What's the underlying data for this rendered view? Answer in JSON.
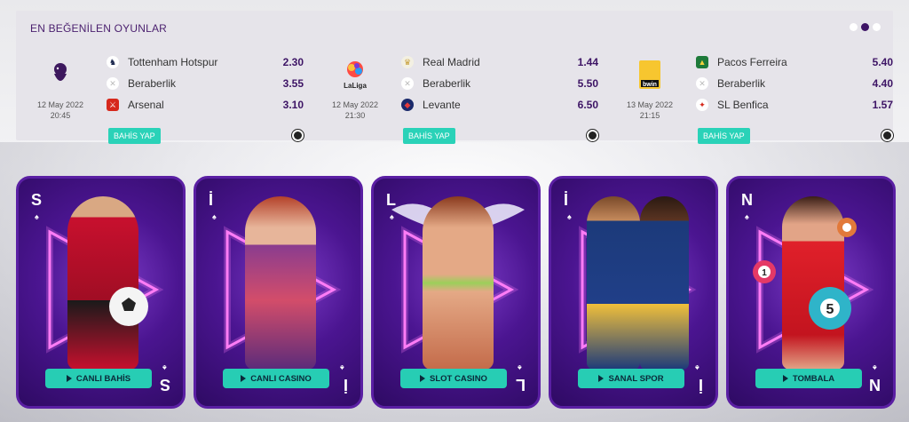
{
  "title": "EN BEĞENİLEN OYUNLAR",
  "bet_label": "BAHİS YAP",
  "matches": [
    {
      "league_icon": "premier-league-icon",
      "date": "12 May 2022",
      "time": "20:45",
      "rows": [
        {
          "team": "Tottenham Hotspur",
          "odd": "2.30",
          "icon": "tottenham-icon"
        },
        {
          "team": "Beraberlik",
          "odd": "3.55",
          "icon": "draw-icon"
        },
        {
          "team": "Arsenal",
          "odd": "3.10",
          "icon": "arsenal-icon"
        }
      ]
    },
    {
      "league_icon": "laliga-icon",
      "league_text": "LaLiga",
      "date": "12 May 2022",
      "time": "21:30",
      "rows": [
        {
          "team": "Real Madrid",
          "odd": "1.44",
          "icon": "real-madrid-icon"
        },
        {
          "team": "Beraberlik",
          "odd": "5.50",
          "icon": "draw-icon"
        },
        {
          "team": "Levante",
          "odd": "6.50",
          "icon": "levante-icon"
        }
      ]
    },
    {
      "league_icon": "liga-portugal-bwin-icon",
      "league_text": "bwin",
      "date": "13 May 2022",
      "time": "21:15",
      "rows": [
        {
          "team": "Pacos Ferreira",
          "odd": "5.40",
          "icon": "pacos-ferreira-icon"
        },
        {
          "team": "Beraberlik",
          "odd": "4.40",
          "icon": "draw-icon"
        },
        {
          "team": "SL Benfica",
          "odd": "1.57",
          "icon": "benfica-icon"
        }
      ]
    }
  ],
  "cards": [
    {
      "letter": "S",
      "label": "CANLI BAHİS"
    },
    {
      "letter": "İ",
      "label": "CANLI CASINO"
    },
    {
      "letter": "L",
      "label": "SLOT CASINO"
    },
    {
      "letter": "İ",
      "label": "SANAL SPOR"
    },
    {
      "letter": "N",
      "label": "TOMBALA"
    }
  ]
}
